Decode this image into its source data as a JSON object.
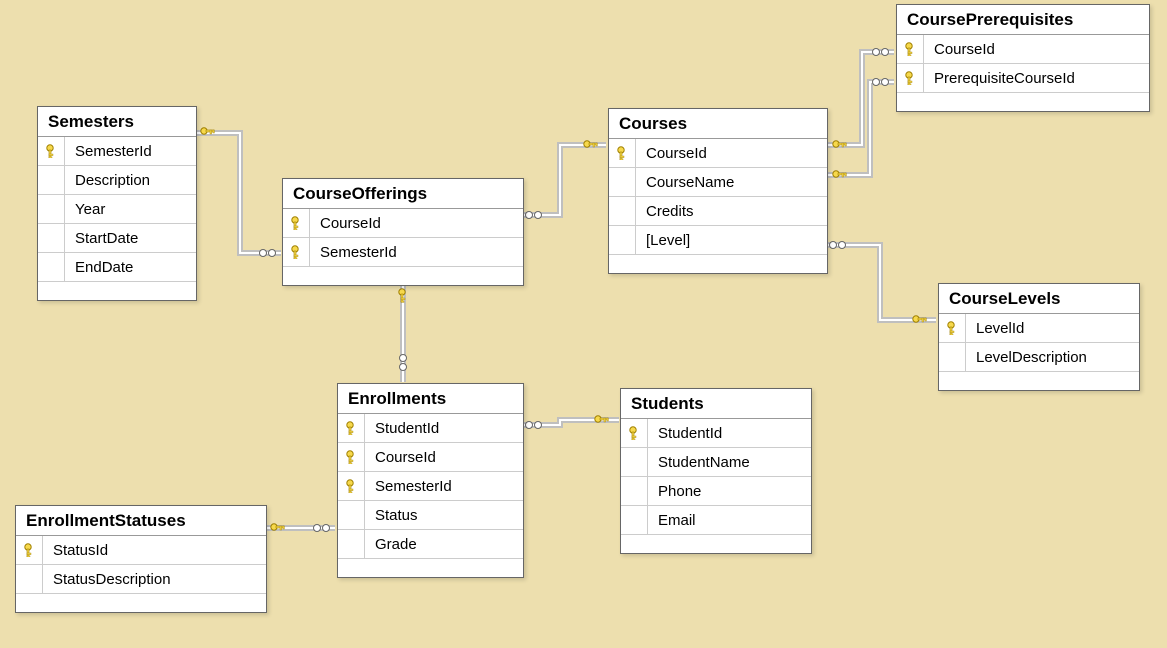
{
  "entities": {
    "semesters": {
      "title": "Semesters",
      "cols": [
        {
          "pk": true,
          "name": "SemesterId"
        },
        {
          "pk": false,
          "name": "Description"
        },
        {
          "pk": false,
          "name": "Year"
        },
        {
          "pk": false,
          "name": "StartDate"
        },
        {
          "pk": false,
          "name": "EndDate"
        }
      ]
    },
    "courseOfferings": {
      "title": "CourseOfferings",
      "cols": [
        {
          "pk": true,
          "name": "CourseId"
        },
        {
          "pk": true,
          "name": "SemesterId"
        }
      ]
    },
    "courses": {
      "title": "Courses",
      "cols": [
        {
          "pk": true,
          "name": "CourseId"
        },
        {
          "pk": false,
          "name": "CourseName"
        },
        {
          "pk": false,
          "name": "Credits"
        },
        {
          "pk": false,
          "name": "[Level]"
        }
      ]
    },
    "coursePrereq": {
      "title": "CoursePrerequisites",
      "cols": [
        {
          "pk": true,
          "name": "CourseId"
        },
        {
          "pk": true,
          "name": "PrerequisiteCourseId"
        }
      ]
    },
    "courseLevels": {
      "title": "CourseLevels",
      "cols": [
        {
          "pk": true,
          "name": "LevelId"
        },
        {
          "pk": false,
          "name": "LevelDescription"
        }
      ]
    },
    "enrollments": {
      "title": "Enrollments",
      "cols": [
        {
          "pk": true,
          "name": "StudentId"
        },
        {
          "pk": true,
          "name": "CourseId"
        },
        {
          "pk": true,
          "name": "SemesterId"
        },
        {
          "pk": false,
          "name": "Status"
        },
        {
          "pk": false,
          "name": "Grade"
        }
      ]
    },
    "students": {
      "title": "Students",
      "cols": [
        {
          "pk": true,
          "name": "StudentId"
        },
        {
          "pk": false,
          "name": "StudentName"
        },
        {
          "pk": false,
          "name": "Phone"
        },
        {
          "pk": false,
          "name": "Email"
        }
      ]
    },
    "enrollStatuses": {
      "title": "EnrollmentStatuses",
      "cols": [
        {
          "pk": true,
          "name": "StatusId"
        },
        {
          "pk": false,
          "name": "StatusDescription"
        }
      ]
    }
  },
  "chart_data": {
    "type": "table",
    "title": "Entity-Relationship Diagram",
    "entities": [
      {
        "name": "Semesters",
        "columns": [
          "SemesterId*",
          "Description",
          "Year",
          "StartDate",
          "EndDate"
        ]
      },
      {
        "name": "CourseOfferings",
        "columns": [
          "CourseId*",
          "SemesterId*"
        ]
      },
      {
        "name": "Courses",
        "columns": [
          "CourseId*",
          "CourseName",
          "Credits",
          "[Level]"
        ]
      },
      {
        "name": "CoursePrerequisites",
        "columns": [
          "CourseId*",
          "PrerequisiteCourseId*"
        ]
      },
      {
        "name": "CourseLevels",
        "columns": [
          "LevelId*",
          "LevelDescription"
        ]
      },
      {
        "name": "Enrollments",
        "columns": [
          "StudentId*",
          "CourseId*",
          "SemesterId*",
          "Status",
          "Grade"
        ]
      },
      {
        "name": "Students",
        "columns": [
          "StudentId*",
          "StudentName",
          "Phone",
          "Email"
        ]
      },
      {
        "name": "EnrollmentStatuses",
        "columns": [
          "StatusId*",
          "StatusDescription"
        ]
      }
    ],
    "relationships": [
      {
        "from": "Semesters",
        "to": "CourseOfferings",
        "type": "one-to-many"
      },
      {
        "from": "Courses",
        "to": "CourseOfferings",
        "type": "one-to-many"
      },
      {
        "from": "Courses",
        "to": "CoursePrerequisites",
        "type": "one-to-many"
      },
      {
        "from": "Courses",
        "to": "CoursePrerequisites",
        "type": "one-to-many"
      },
      {
        "from": "CourseLevels",
        "to": "Courses",
        "type": "one-to-many"
      },
      {
        "from": "CourseOfferings",
        "to": "Enrollments",
        "type": "one-to-many"
      },
      {
        "from": "Students",
        "to": "Enrollments",
        "type": "one-to-many"
      },
      {
        "from": "EnrollmentStatuses",
        "to": "Enrollments",
        "type": "one-to-many"
      }
    ]
  }
}
